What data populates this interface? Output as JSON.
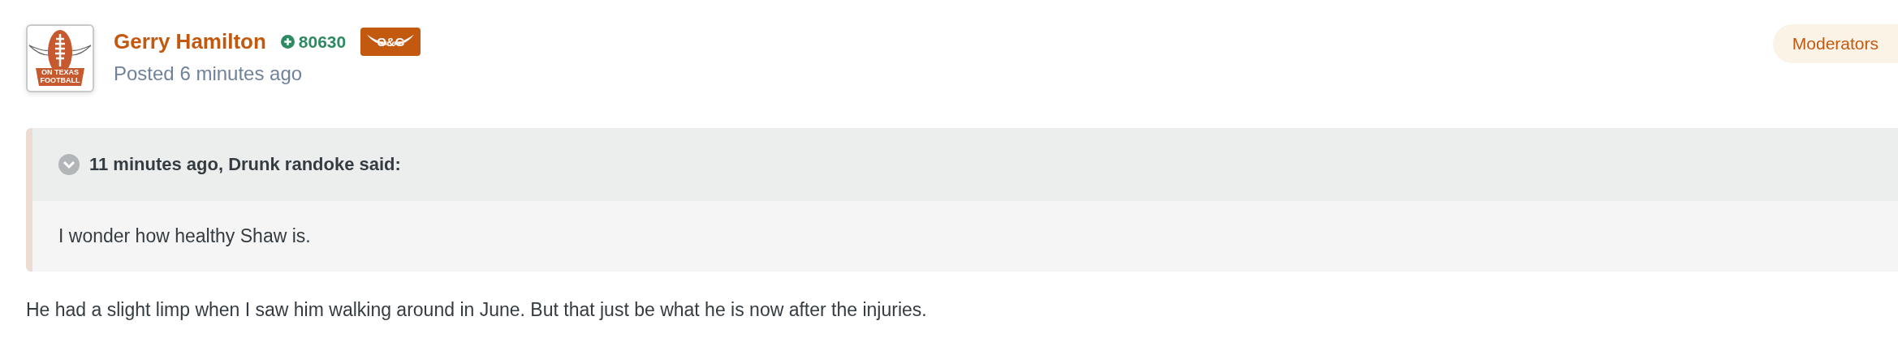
{
  "author": {
    "name": "Gerry Hamilton",
    "reputation": "80630",
    "badge": "O&G",
    "avatar_text": [
      "ON TEXAS",
      "FOOTBALL"
    ],
    "posted": "Posted 6 minutes ago",
    "group": "Moderators"
  },
  "quote": {
    "expanded": false,
    "citation": "11 minutes ago, Drunk randoke said:",
    "text": "I wonder how healthy Shaw is."
  },
  "body": "He had a slight limp when I saw him walking around in June. But that just be what he is now after the injuries."
}
